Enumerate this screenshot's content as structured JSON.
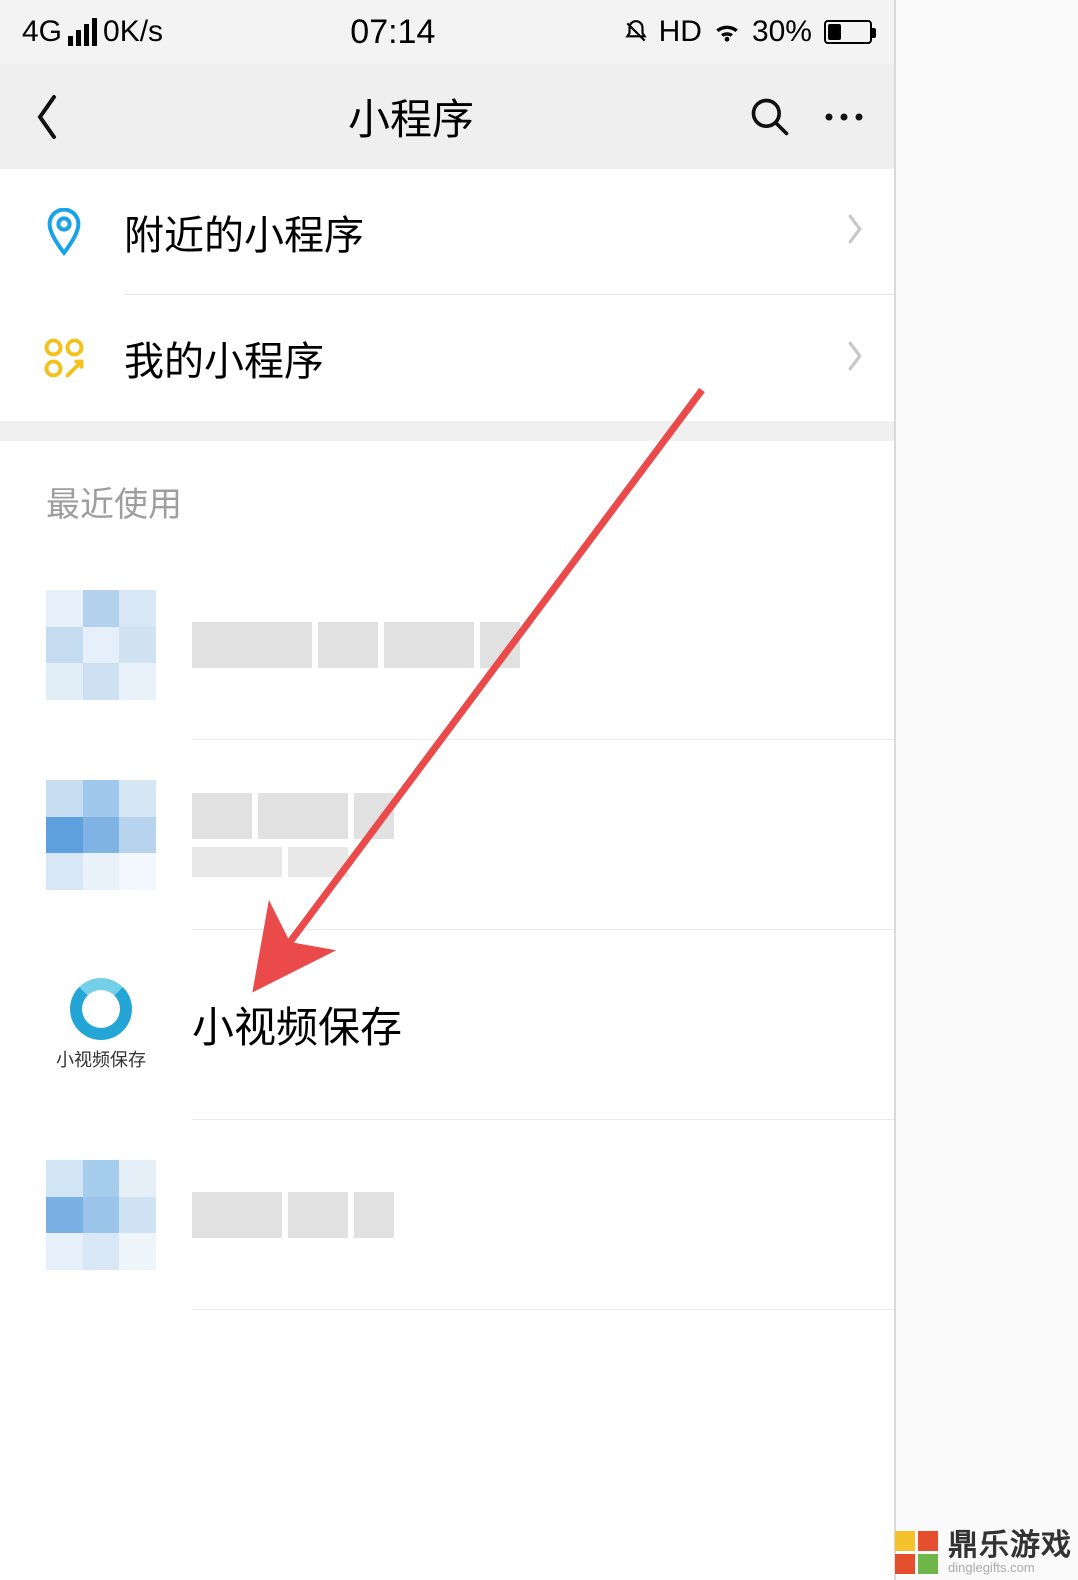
{
  "statusBar": {
    "network": "4G",
    "speed": "0K/s",
    "time": "07:14",
    "hd": "HD",
    "batteryPercent": "30%"
  },
  "navBar": {
    "title": "小程序"
  },
  "topList": {
    "nearby": "附近的小程序",
    "mine": "我的小程序"
  },
  "sections": {
    "recentTitle": "最近使用"
  },
  "recent": {
    "visibleItem": {
      "name": "小视频保存",
      "avatarCaption": "小视频保存"
    }
  },
  "watermark": {
    "name": "鼎乐游戏",
    "domain": "dinglegifts.com"
  }
}
